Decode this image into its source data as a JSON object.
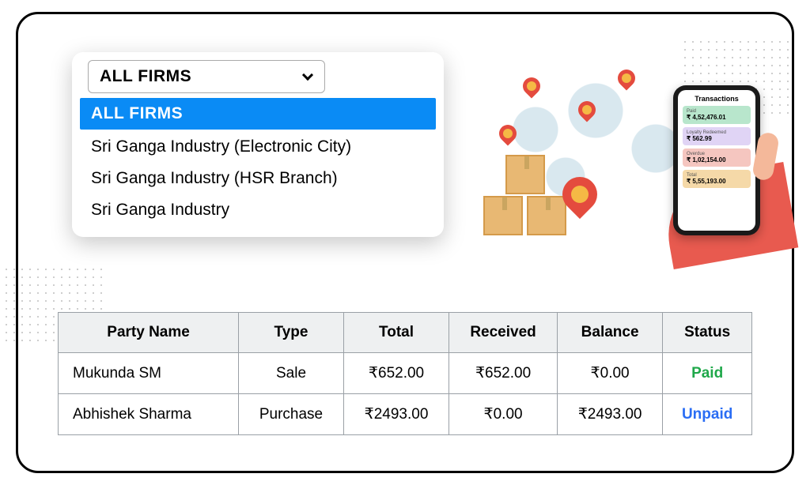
{
  "dropdown": {
    "selected_label": "ALL FIRMS",
    "options": [
      "ALL FIRMS",
      "Sri Ganga Industry (Electronic City)",
      "Sri Ganga Industry (HSR Branch)",
      "Sri Ganga Industry"
    ]
  },
  "phone": {
    "title": "Transactions",
    "stats": [
      {
        "label": "Paid",
        "value": "₹ 4,52,476.01"
      },
      {
        "label": "Loyalty Redeemed",
        "value": "₹ 562.99"
      },
      {
        "label": "Overdue",
        "value": "₹ 1,02,154.00"
      },
      {
        "label": "Total",
        "value": "₹ 5,55,193.00"
      }
    ]
  },
  "table": {
    "headers": [
      "Party Name",
      "Type",
      "Total",
      "Received",
      "Balance",
      "Status"
    ],
    "rows": [
      {
        "party": "Mukunda SM",
        "type": "Sale",
        "total": "₹652.00",
        "received": "₹652.00",
        "balance": "₹0.00",
        "status": "Paid",
        "status_class": "status-paid"
      },
      {
        "party": "Abhishek Sharma",
        "type": "Purchase",
        "total": "₹2493.00",
        "received": "₹0.00",
        "balance": "₹2493.00",
        "status": "Unpaid",
        "status_class": "status-unpaid"
      }
    ]
  }
}
